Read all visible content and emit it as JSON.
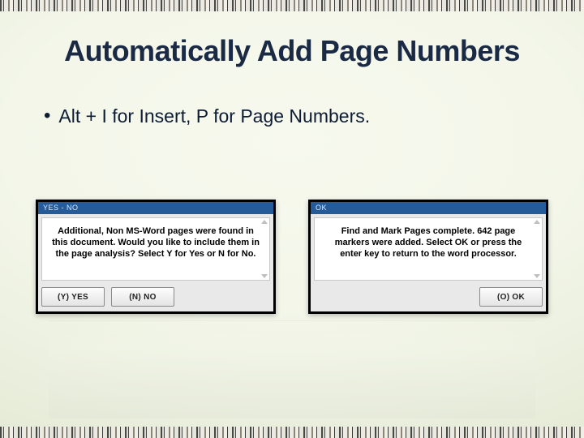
{
  "slide": {
    "title": "Automatically Add Page Numbers",
    "bullet": "Alt + I for Insert, P for Page Numbers."
  },
  "dialogs": {
    "yesno": {
      "titlebar": "YES - NO",
      "message": "Additional, Non MS-Word pages were found in this document.  Would you like to include them in the page analysis?  Select Y for Yes or N for No.",
      "buttons": {
        "yes": "(Y) YES",
        "no": "(N) NO"
      }
    },
    "ok": {
      "titlebar": "OK",
      "message": "Find and Mark Pages complete.  642 page markers were added.  Select OK or press the enter key to return to the word processor.",
      "buttons": {
        "ok": "(O) OK"
      }
    }
  }
}
